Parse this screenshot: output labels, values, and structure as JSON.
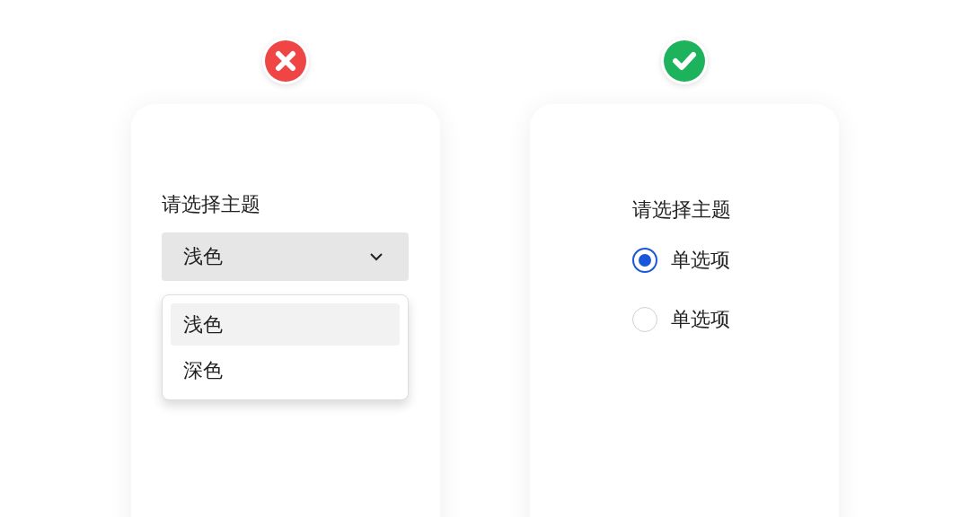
{
  "panels": [
    {
      "kind": "dropdown",
      "verdict": {
        "kind": "bad"
      },
      "label": "请选择主题",
      "select": {
        "value": "浅色",
        "expanded": true
      },
      "options": [
        {
          "label": "浅色",
          "selected": true
        },
        {
          "label": "深色",
          "selected": false
        }
      ]
    },
    {
      "kind": "radios",
      "verdict": {
        "kind": "good"
      },
      "label": "请选择主题",
      "options": [
        {
          "label": "单选项",
          "selected": true
        },
        {
          "label": "单选项",
          "selected": false
        }
      ]
    }
  ]
}
